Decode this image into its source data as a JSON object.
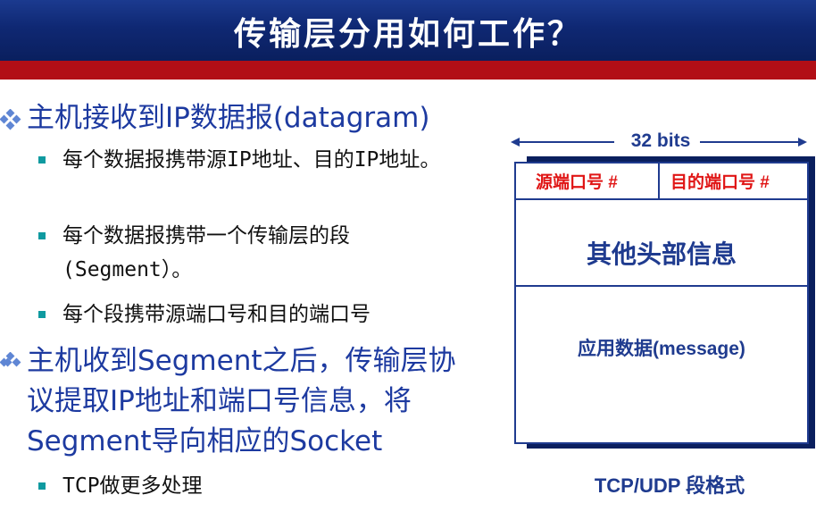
{
  "title": "传输层分用如何工作？",
  "bullets": [
    {
      "text": "主机接收到IP数据报(datagram)",
      "sub": [
        "每个数据报携带源IP地址、目的IP地址。",
        "每个数据报携带一个传输层的段(Segment）。",
        "每个段携带源端口号和目的端口号"
      ]
    },
    {
      "text": "主机收到Segment之后，传输层协议提取IP地址和端口号信息，将Segment导向相应的Socket",
      "sub": [
        "TCP做更多处理"
      ]
    }
  ],
  "diagram": {
    "width_label": "32 bits",
    "src_port": "源端口号 #",
    "dst_port": "目的端口号 #",
    "other_headers": "其他头部信息",
    "app_data": "应用数据(message)",
    "caption": "TCP/UDP 段格式"
  },
  "colors": {
    "title_bg": "#0f2873",
    "stripe": "#b20e16",
    "bullet_text": "#1d3aa0",
    "port_text": "#e01515",
    "diagram": "#1f3b8f"
  }
}
